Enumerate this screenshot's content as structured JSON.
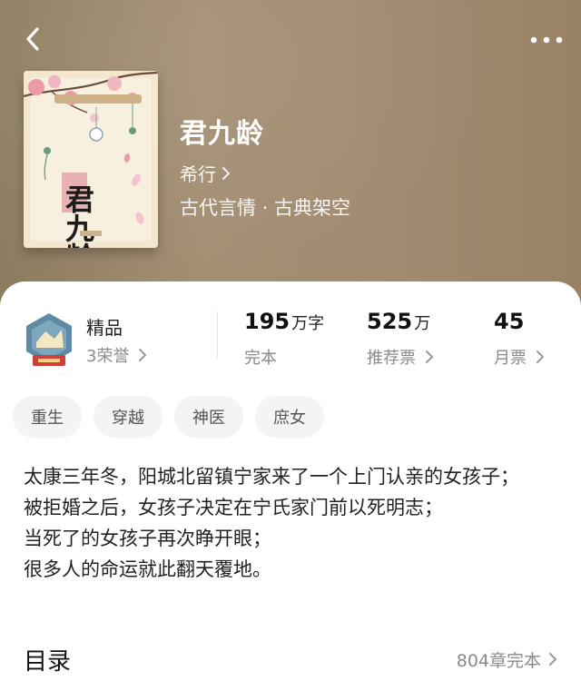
{
  "header": {
    "back_icon": "chevron-left-icon",
    "more_icon": "more-dots-icon"
  },
  "book": {
    "cover_title": "君九龄",
    "title": "君九龄",
    "author": "希行",
    "genre": "古代言情 · 古典架空"
  },
  "stats": {
    "badge_icon": "honor-badge-icon",
    "badge_label": "精品",
    "honors": "3荣誉",
    "word_count": "195",
    "word_unit": "万字",
    "status": "完本",
    "recommend_votes": "525",
    "recommend_unit": "万",
    "recommend_label": "推荐票",
    "monthly_votes": "45",
    "monthly_label": "月票"
  },
  "tags": [
    "重生",
    "穿越",
    "神医",
    "庶女"
  ],
  "summary": [
    "太康三年冬，阳城北留镇宁家来了一个上门认亲的女孩子；",
    "被拒婚之后，女孩子决定在宁氏家门前以死明志；",
    "当死了的女孩子再次睁开眼；",
    "很多人的命运就此翻天覆地。"
  ],
  "toc": {
    "title": "目录",
    "info": "804章完本"
  }
}
